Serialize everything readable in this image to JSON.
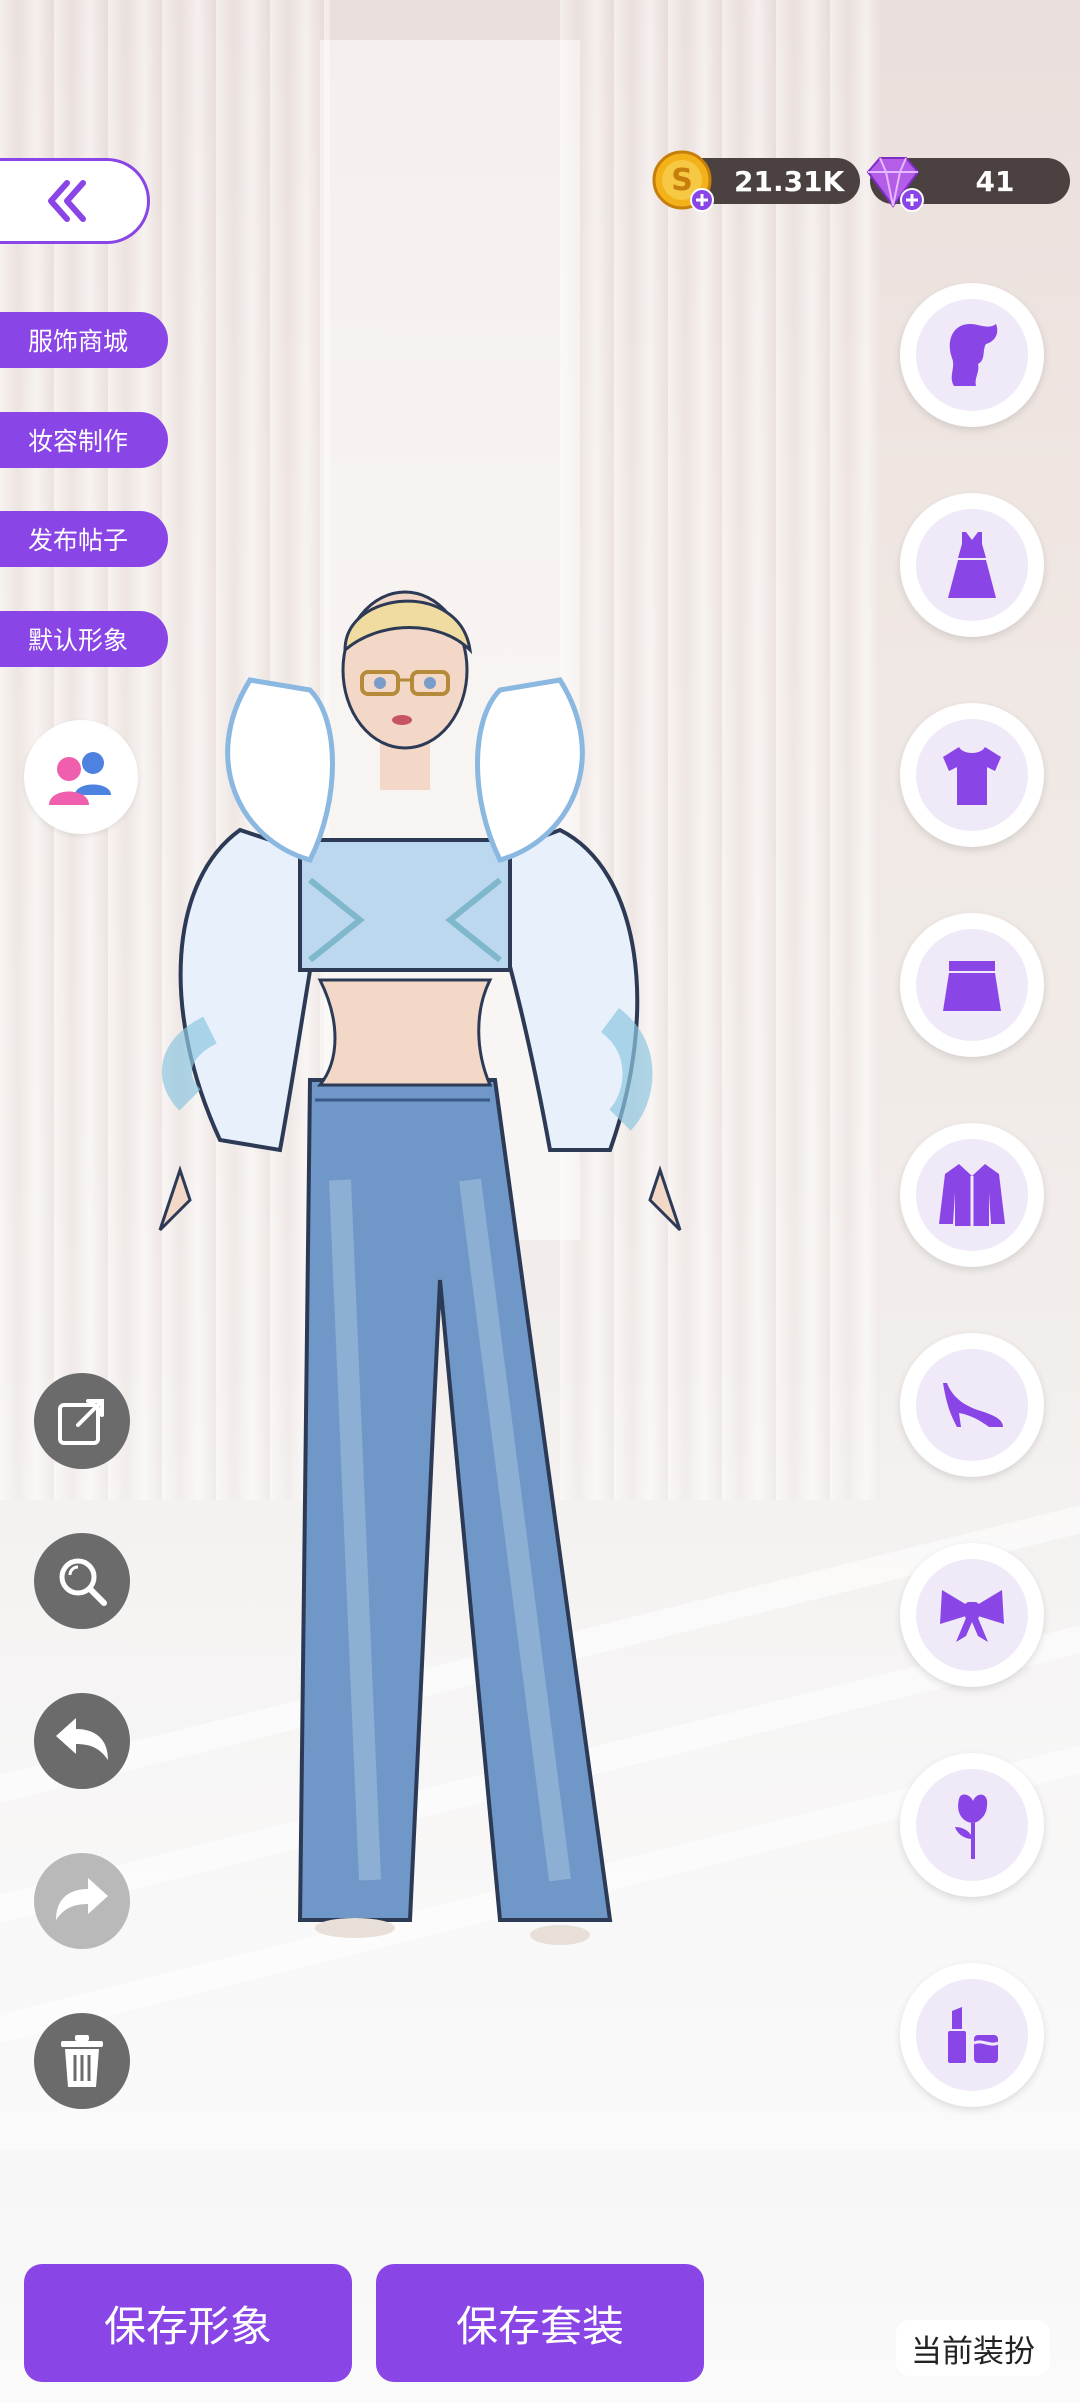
{
  "header": {
    "coins": "21.31K",
    "gems": "41"
  },
  "left_menu": {
    "items": [
      {
        "label": "服饰商城"
      },
      {
        "label": "妆容制作"
      },
      {
        "label": "发布帖子"
      },
      {
        "label": "默认形象"
      }
    ]
  },
  "right_categories": [
    {
      "icon": "hair-icon"
    },
    {
      "icon": "dress-icon"
    },
    {
      "icon": "top-icon"
    },
    {
      "icon": "skirt-icon"
    },
    {
      "icon": "jacket-icon"
    },
    {
      "icon": "high-heel-icon"
    },
    {
      "icon": "bow-icon"
    },
    {
      "icon": "rose-icon"
    },
    {
      "icon": "makeup-icon"
    }
  ],
  "tools": [
    {
      "icon": "share-icon"
    },
    {
      "icon": "zoom-icon"
    },
    {
      "icon": "undo-icon"
    },
    {
      "icon": "redo-icon"
    },
    {
      "icon": "trash-icon"
    }
  ],
  "bottom": {
    "save_look": "保存形象",
    "save_outfit": "保存套装",
    "current_outfit": "当前装扮"
  },
  "colors": {
    "accent": "#8a45e6",
    "currency_bg": "#4b4141",
    "tool_bg": "#6b6b6b"
  }
}
